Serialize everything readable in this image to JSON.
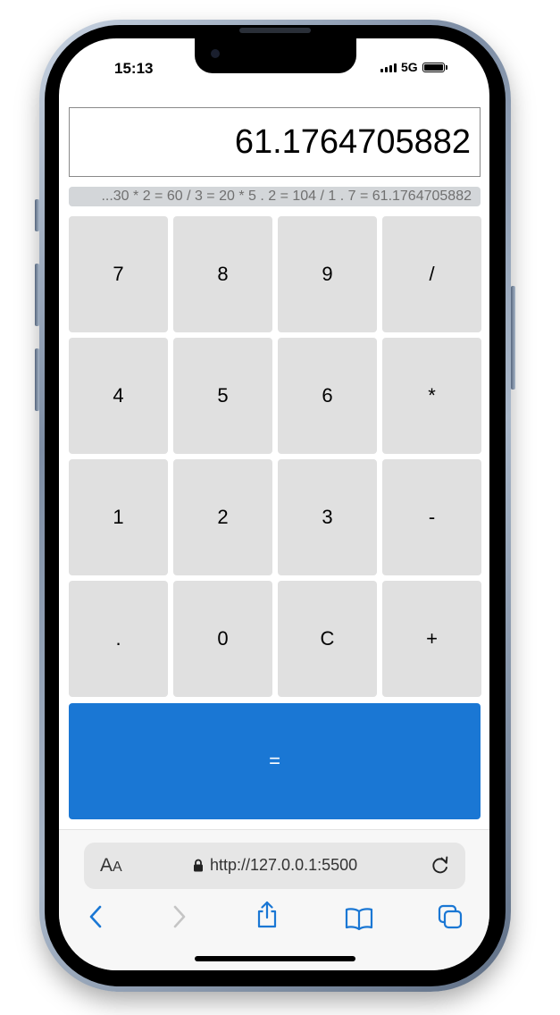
{
  "status_bar": {
    "time": "15:13",
    "network": "5G"
  },
  "calculator": {
    "display": "61.1764705882",
    "history": "...30 * 2 = 60 / 3 = 20 * 5 . 2 = 104 / 1 . 7 = 61.1764705882",
    "keys": [
      "7",
      "8",
      "9",
      "/",
      "4",
      "5",
      "6",
      "*",
      "1",
      "2",
      "3",
      "-",
      ".",
      "0",
      "C",
      "+"
    ],
    "equals": "="
  },
  "browser": {
    "text_size_label": "A",
    "text_size_label_small": "A",
    "url": "http://127.0.0.1:5500",
    "accent_color": "#1a77d4",
    "toolbar_icons": [
      "back-icon",
      "forward-icon",
      "share-icon",
      "bookmarks-icon",
      "tabs-icon"
    ]
  }
}
